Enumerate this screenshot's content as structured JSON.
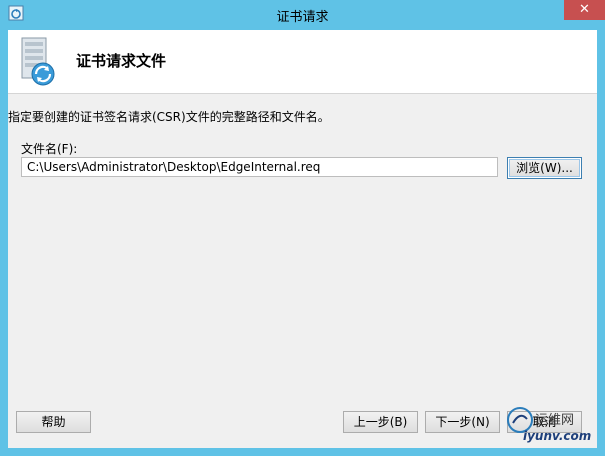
{
  "window": {
    "title": "证书请求",
    "close_label": "✕"
  },
  "header": {
    "title": "证书请求文件"
  },
  "body": {
    "description": "指定要创建的证书签名请求(CSR)文件的完整路径和文件名。",
    "filename_label": "文件名(F):",
    "filename_value": "C:\\Users\\Administrator\\Desktop\\EdgeInternal.req",
    "browse_label": "浏览(W)..."
  },
  "footer": {
    "help_label": "帮助",
    "back_label": "上一步(B)",
    "next_label": "下一步(N)",
    "cancel_label": "取消"
  },
  "watermark": {
    "text_cn": "运维网",
    "text_en": "iyunv.com"
  },
  "colors": {
    "frame": "#5fc2e6",
    "close": "#c75050",
    "client_bg": "#f0f0f0"
  }
}
